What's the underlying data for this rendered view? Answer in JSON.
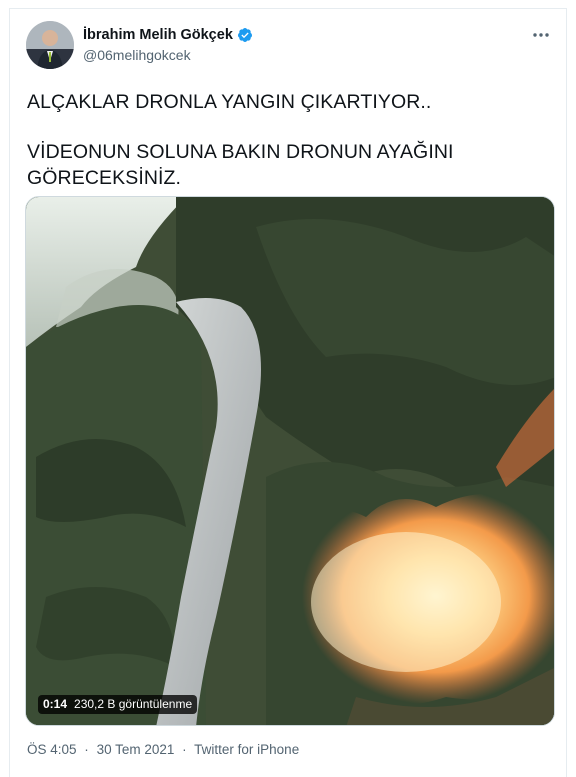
{
  "user": {
    "display_name": "İbrahim Melih Gökçek",
    "handle": "@06melihgokcek",
    "verified": true,
    "avatar_icon": "user-avatar"
  },
  "tweet": {
    "line1": "ALÇAKLAR DRONLA YANGIN ÇIKARTIYOR..",
    "line2": "VİDEONUN SOLUNA BAKIN DRONUN AYAĞINI",
    "line3": "GÖRECEKSİNİZ."
  },
  "video": {
    "duration": "0:14",
    "views": "230,2 B görüntülenme"
  },
  "meta": {
    "time": "ÖS 4:05",
    "separator": "·",
    "date": "30 Tem 2021",
    "source": "Twitter for iPhone"
  },
  "colors": {
    "verified": "#1d9bf0",
    "muted_text": "#536471",
    "border": "#e6ecf0"
  },
  "icons": {
    "more": "more-horizontal-icon",
    "verified": "verified-badge-icon"
  }
}
